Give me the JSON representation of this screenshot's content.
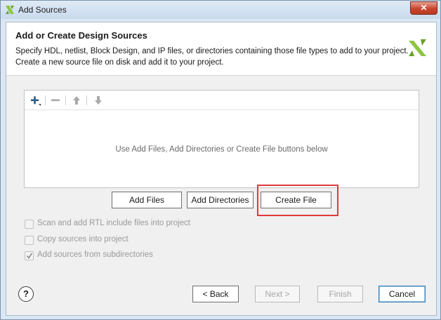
{
  "window": {
    "title": "Add Sources",
    "close_label": "✕"
  },
  "header": {
    "title": "Add or Create Design Sources",
    "description_line1": "Specify HDL, netlist, Block Design, and IP files, or directories containing those file types to add to your project.",
    "description_line2": "Create a new source file on disk and add it to your project."
  },
  "file_list": {
    "toolbar": {
      "add_icon": "plus-icon",
      "remove_icon": "minus-icon",
      "up_icon": "arrow-up-icon",
      "down_icon": "arrow-down-icon"
    },
    "empty_message": "Use Add Files, Add Directories or Create File buttons below"
  },
  "actions": {
    "add_files": "Add Files",
    "add_directories": "Add Directories",
    "create_file": "Create File"
  },
  "options": [
    {
      "label": "Scan and add RTL include files into project",
      "checked": false,
      "enabled": false
    },
    {
      "label": "Copy sources into project",
      "checked": false,
      "enabled": false
    },
    {
      "label": "Add sources from subdirectories",
      "checked": true,
      "enabled": false
    }
  ],
  "footer": {
    "help_label": "?",
    "back": "< Back",
    "next": "Next >",
    "finish": "Finish",
    "cancel": "Cancel"
  },
  "colors": {
    "highlight": "#e03a3a",
    "accent": "#3c7fb1",
    "logo": "#8cc63f"
  }
}
